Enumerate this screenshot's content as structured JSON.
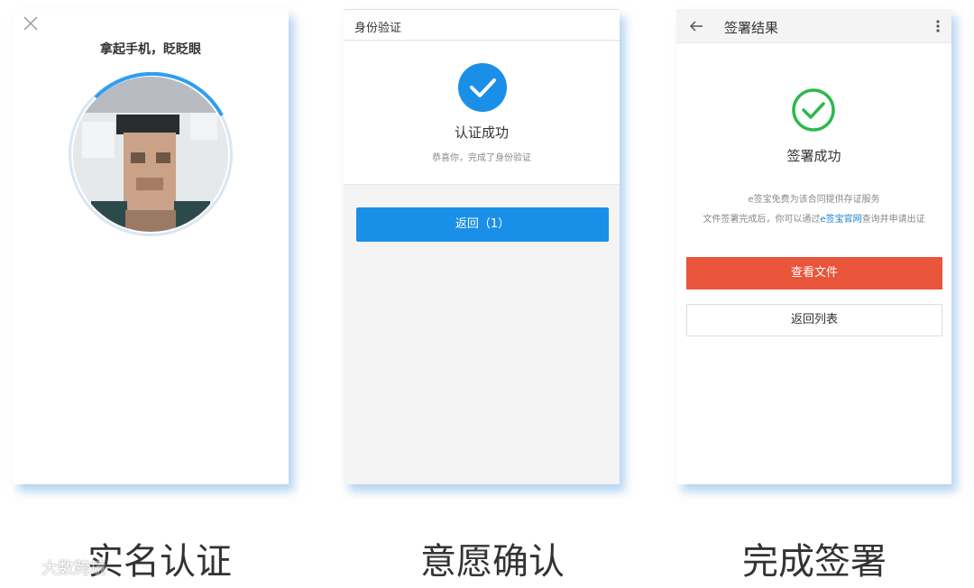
{
  "screens": [
    {
      "title": "拿起手机，眨眨眼",
      "caption": "实名认证"
    },
    {
      "header_title": "身份验证",
      "success_title": "认证成功",
      "success_subtitle": "恭喜你，完成了身份验证",
      "back_button": "返回（1）",
      "caption": "意愿确认"
    },
    {
      "header_title": "签署结果",
      "success_title": "签署成功",
      "info_line1": "e签宝免费为该合同提供存证服务",
      "info_line2_prefix": "文件签署完成后，你可以通过",
      "info_line2_link": "e签宝官网",
      "info_line2_suffix": "查询并申请出证",
      "view_file_button": "查看文件",
      "back_list_button": "返回列表",
      "caption": "完成签署"
    }
  ],
  "watermark": "大数跨境",
  "colors": {
    "primary_blue": "#1a8fe8",
    "success_green": "#2db84d",
    "action_red": "#e8553a",
    "link_blue": "#1a7fd4",
    "panel_shadow": "#78afe6"
  },
  "icons": [
    "close-icon",
    "check-icon",
    "back-arrow-icon",
    "more-vertical-icon",
    "check-circle-icon",
    "weibo-logo-icon"
  ]
}
